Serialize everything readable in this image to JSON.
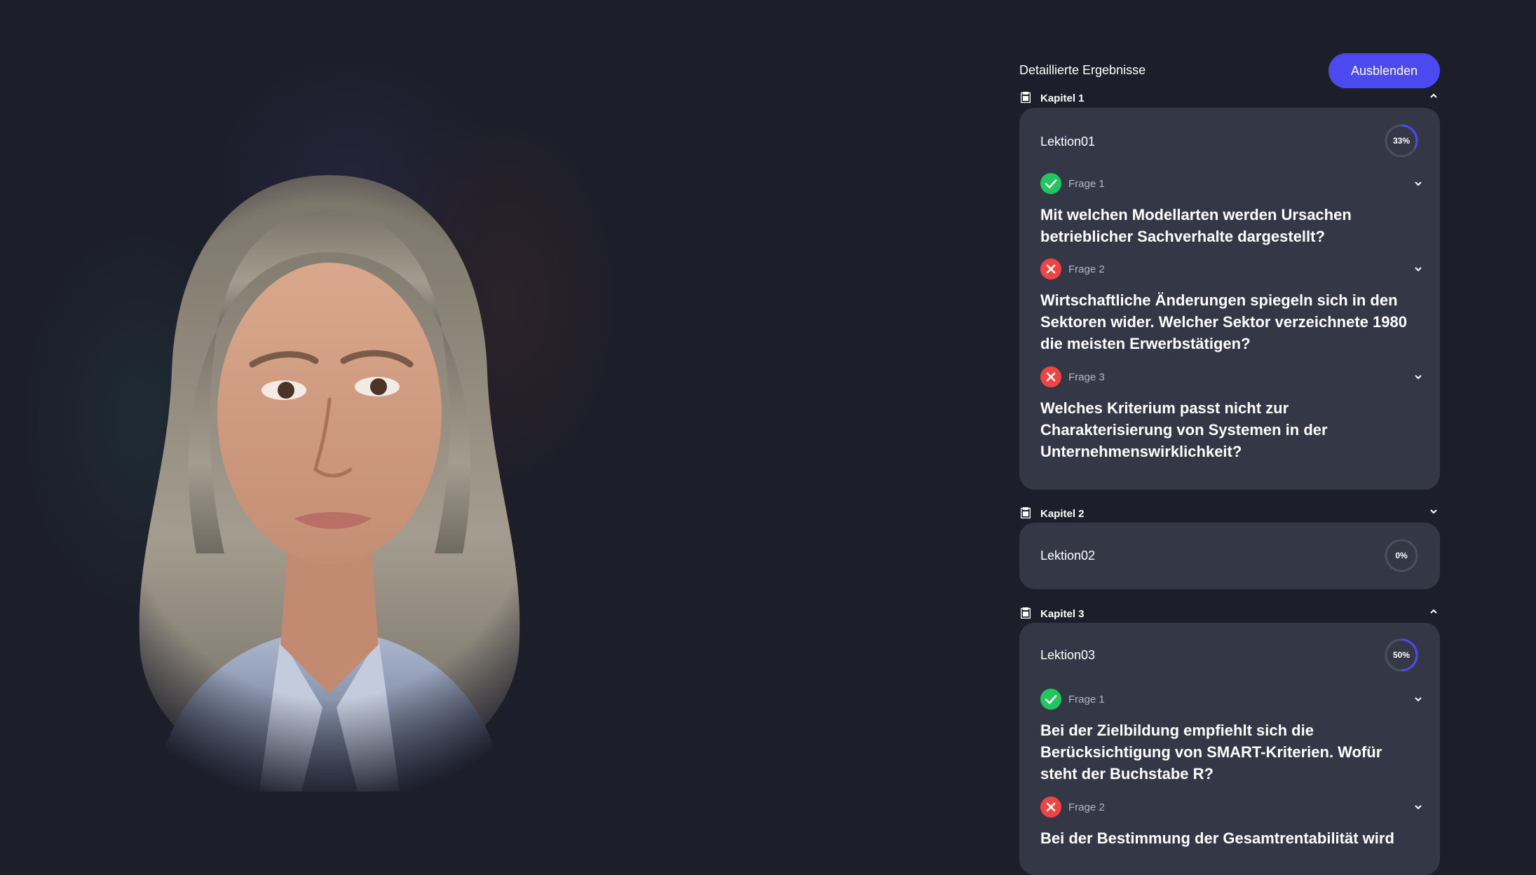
{
  "panel": {
    "title": "Detaillierte Ergebnisse",
    "hide_label": "Ausblenden"
  },
  "chapters": [
    {
      "label": "Kapitel 1",
      "expanded": true,
      "lesson": {
        "title": "Lektion01",
        "progress_text": "33%",
        "progress": 0.33,
        "questions": [
          {
            "label": "Frage 1",
            "status": "correct",
            "text": "Mit welchen Modellarten werden Ursachen betrieblicher Sachverhalte dargestellt?"
          },
          {
            "label": "Frage 2",
            "status": "incorrect",
            "text": "Wirtschaftliche Änderungen spiegeln sich in den Sektoren wider. Welcher Sektor verzeichnete 1980 die meisten Erwerbstätigen?"
          },
          {
            "label": "Frage 3",
            "status": "incorrect",
            "text": "Welches Kriterium passt nicht zur Charakterisierung von Systemen in der Unternehmenswirklichkeit?"
          }
        ]
      }
    },
    {
      "label": "Kapitel 2",
      "expanded": false,
      "lesson": {
        "title": "Lektion02",
        "progress_text": "0%",
        "progress": 0,
        "questions": []
      }
    },
    {
      "label": "Kapitel 3",
      "expanded": true,
      "lesson": {
        "title": "Lektion03",
        "progress_text": "50%",
        "progress": 0.5,
        "questions": [
          {
            "label": "Frage 1",
            "status": "correct",
            "text": "Bei der Zielbildung empfiehlt sich die Berücksichtigung von SMART-Kriterien. Wofür steht der Buchstabe R?"
          },
          {
            "label": "Frage 2",
            "status": "incorrect",
            "text": "Bei der Bestimmung der Gesamtrentabilität wird"
          }
        ]
      }
    }
  ],
  "colors": {
    "background": "#1c1e2a",
    "card": "#343846",
    "accent": "#4a4af0",
    "correct": "#22c55e",
    "incorrect": "#ef4444",
    "muted_text": "#b4b7c4"
  },
  "icons": {
    "chapter": "book-icon",
    "correct": "check-circle-icon",
    "incorrect": "x-circle-icon",
    "expand": "chevron-down-icon",
    "collapse": "chevron-up-icon"
  }
}
